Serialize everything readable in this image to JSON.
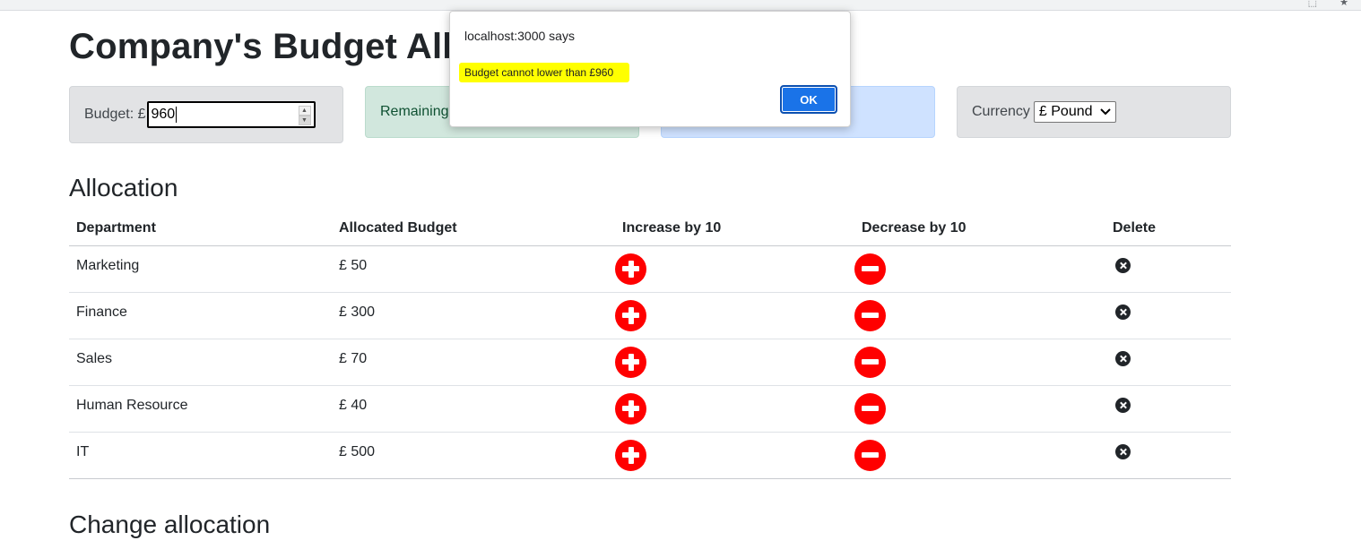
{
  "page": {
    "title": "Company's Budget Allo"
  },
  "budget_card": {
    "label": "Budget: £",
    "value": "960"
  },
  "remaining_card": {
    "label": "Remaining:"
  },
  "currency_card": {
    "label": "Currency",
    "selected": "£ Pound"
  },
  "allocation": {
    "heading": "Allocation",
    "columns": [
      "Department",
      "Allocated Budget",
      "Increase by 10",
      "Decrease by 10",
      "Delete"
    ],
    "rows": [
      {
        "department": "Marketing",
        "budget": "£ 50"
      },
      {
        "department": "Finance",
        "budget": "£ 300"
      },
      {
        "department": "Sales",
        "budget": "£ 70"
      },
      {
        "department": "Human Resource",
        "budget": "£ 40"
      },
      {
        "department": "IT",
        "budget": "£ 500"
      }
    ]
  },
  "change_allocation": {
    "heading": "Change allocation"
  },
  "dialog": {
    "title": "localhost:3000 says",
    "message": "Budget cannot lower than £960",
    "ok_label": "OK"
  },
  "colors": {
    "button_red": "#ff0000",
    "dialog_highlight": "#ffff00",
    "ok_blue": "#1a73e8"
  },
  "icons": {
    "increase": "plus-circle-icon",
    "decrease": "minus-circle-icon",
    "delete": "close-circle-icon"
  }
}
